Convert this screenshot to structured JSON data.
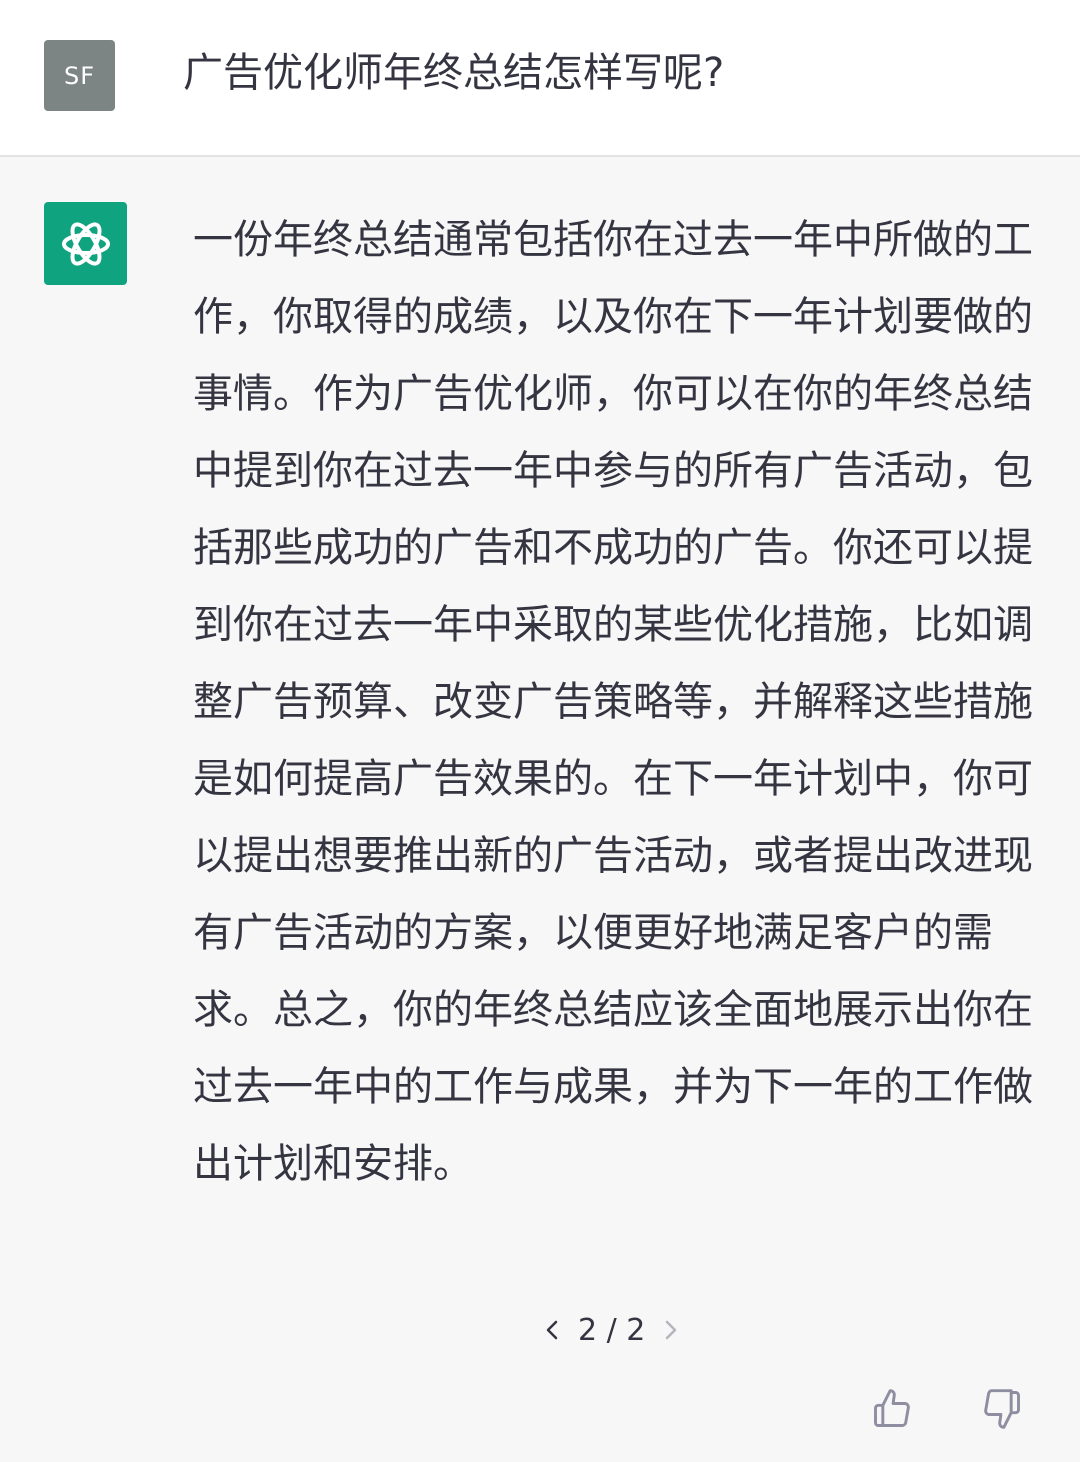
{
  "user": {
    "avatar_initials": "SF",
    "message": "广告优化师年终总结怎样写呢?"
  },
  "assistant": {
    "avatar_icon": "openai-logo-icon",
    "message": "一份年终总结通常包括你在过去一年中所做的工作，你取得的成绩，以及你在下一年计划要做的事情。作为广告优化师，你可以在你的年终总结中提到你在过去一年中参与的所有广告活动，包括那些成功的广告和不成功的广告。你还可以提到你在过去一年中采取的某些优化措施，比如调整广告预算、改变广告策略等，并解释这些措施是如何提高广告效果的。在下一年计划中，你可以提出想要推出新的广告活动，或者提出改进现有广告活动的方案，以便更好地满足客户的需求。总之，你的年终总结应该全面地展示出你在过去一年中的工作与成果，并为下一年的工作做出计划和安排。"
  },
  "pager": {
    "label": "2 / 2",
    "prev_icon": "chevron-left-icon",
    "next_icon": "chevron-right-icon"
  },
  "feedback": {
    "like_icon": "thumbs-up-icon",
    "dislike_icon": "thumbs-down-icon"
  },
  "colors": {
    "brand": "#10a37f",
    "user_avatar": "#7d8584",
    "assistant_bg": "#f7f7f8",
    "text": "#343541"
  }
}
